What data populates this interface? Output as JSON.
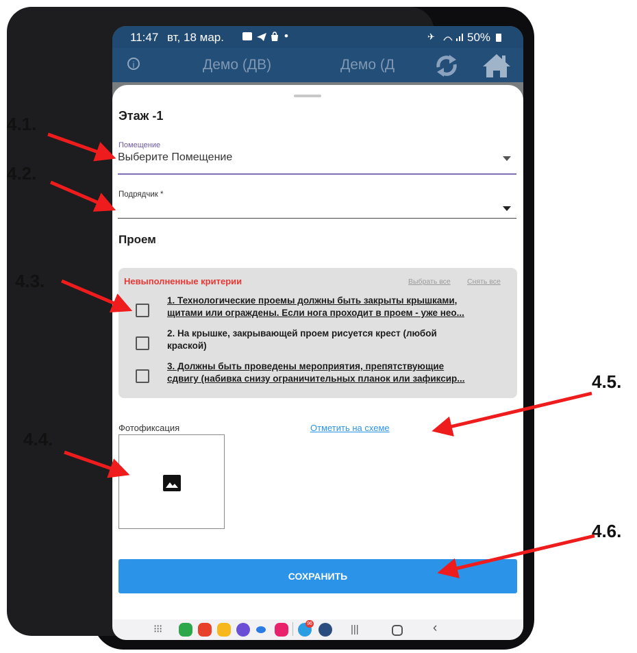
{
  "status_bar": {
    "time": "11:47",
    "date": "вт, 18 мар.",
    "battery": "50%"
  },
  "app_bar": {
    "title_left": "Демо (ДВ)",
    "title_right": "Демо (Д"
  },
  "form": {
    "floor_title": "Этаж -1",
    "room": {
      "label": "Помещение",
      "value": "Выберите Помещение"
    },
    "contractor": {
      "label": "Подрядчик *",
      "value": ""
    },
    "section_title": "Проем",
    "criteria": {
      "header": "Невыполненные критерии",
      "select_all": "Выбрать все",
      "clear_all": "Снять все",
      "items": [
        {
          "line1": "1. Технологические проемы должны быть закрыты крышками,",
          "line2": "щитами или ограждены. Если нога проходит в проем - уже нео...",
          "checked": false
        },
        {
          "line1": "2. На крышке, закрывающей проем рисуется крест (любой",
          "line2": "краской)",
          "checked": false
        },
        {
          "line1": "3. Должны быть проведены мероприятия, препятствующие",
          "line2": "сдвигу (набивка снизу ограничительных планок или зафиксир...",
          "checked": false
        }
      ]
    },
    "photo_label": "Фотофиксация",
    "mark_on_scheme": "Отметить на схеме",
    "save_button": "СОХРАНИТЬ"
  },
  "callouts": {
    "c41": "4.1.",
    "c42": "4.2.",
    "c43": "4.3.",
    "c44": "4.4.",
    "c45": "4.5.",
    "c46": "4.6."
  },
  "nav_badge": "96",
  "colors": {
    "app_bar": "#234e78",
    "accent": "#2b93e8",
    "error": "#e53935",
    "annotation": "#ee1c1c"
  }
}
